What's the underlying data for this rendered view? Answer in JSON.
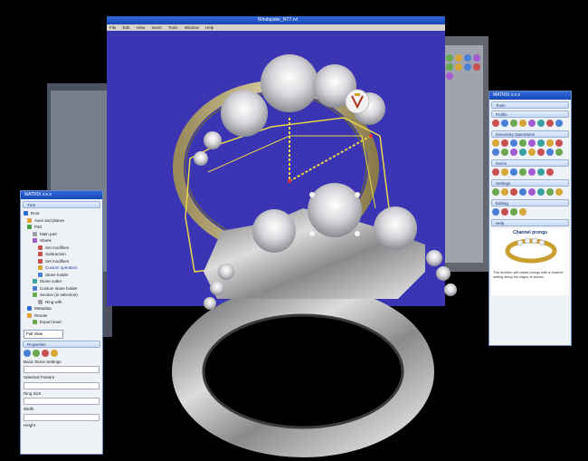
{
  "main_window": {
    "title": "Windspider_NT7.rvl",
    "menu": [
      "File",
      "Edit",
      "View",
      "Insert",
      "Tools",
      "Window",
      "Help"
    ]
  },
  "left_panel": {
    "title": "MATRIX v.x.x",
    "tab": "Tree",
    "tree": [
      "Root",
      "Axes and planes",
      "Part",
      "Main part",
      "Shank",
      "Set modifiers",
      "Subtraction",
      "Set modifiers",
      "Custom operation",
      "Stone holder",
      "Stone cutter",
      "Custom stone holder",
      "Section (in selection)",
      "Ring with",
      "Metadata",
      "Render",
      "Export level"
    ],
    "dropdown": "Full View",
    "properties_tab": "Properties",
    "field_labels": [
      "Basic Stone Settings",
      "Selected Feature",
      "Ring Size",
      "Width",
      "Height"
    ]
  },
  "right_panel": {
    "title": "MATRIX v.x.x",
    "tab": "Tools",
    "sections": [
      "Profile",
      "Geometry Operations",
      "Gems",
      "Settings",
      "Editing"
    ],
    "preview_tab": "Help",
    "preview_title": "Channel prongs",
    "preview_text": "This function will create prongs with a channel setting along the edges of stones."
  },
  "colors": {
    "viewport": "#3b35b4",
    "titlebar": "#2456c8",
    "panel": "#eef1f6",
    "metal": "#c9c9c9",
    "gold_wire": "#e7d64a"
  }
}
